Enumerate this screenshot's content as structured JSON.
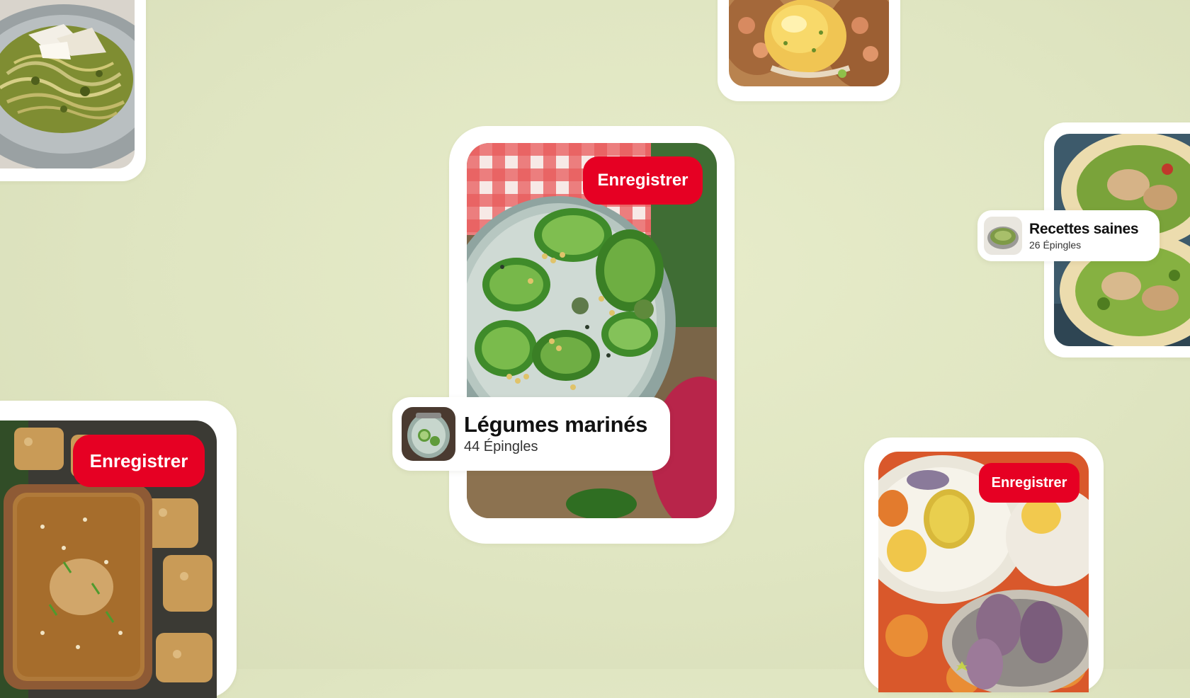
{
  "colors": {
    "background": "#e3e8c6",
    "card": "#ffffff",
    "save_button": "#e60023",
    "text_primary": "#111111"
  },
  "pins": {
    "pasta": {
      "image": "pesto-spaghetti-photo"
    },
    "eggs": {
      "image": "eggs-benedict-photo"
    },
    "wrap": {
      "image": "chicken-wrap-photo"
    },
    "pickles": {
      "image": "pickled-cucumbers-jar-photo",
      "save_label": "Enregistrer"
    },
    "tofu": {
      "image": "crispy-tofu-sesame-sauce-photo",
      "save_label": "Enregistrer"
    },
    "fruits": {
      "image": "pears-artichokes-table-photo",
      "save_label": "Enregistrer"
    }
  },
  "boards": {
    "pickled": {
      "name": "Légumes marinés",
      "count": "44 Épingles"
    },
    "healthy": {
      "name": "Recettes saines",
      "count": "26 Épingles"
    }
  }
}
